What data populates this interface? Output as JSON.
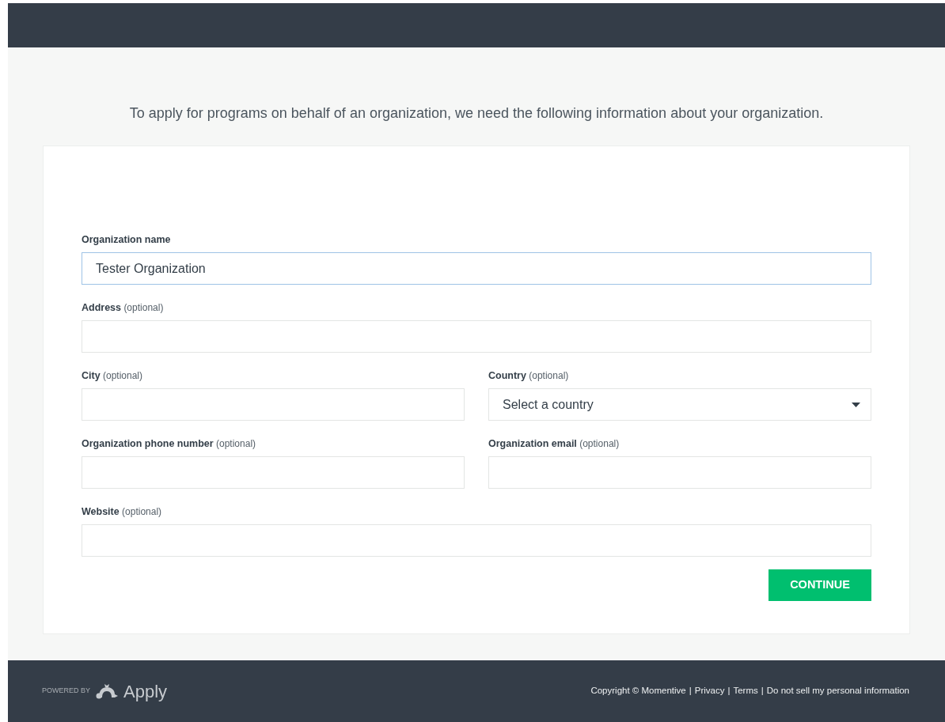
{
  "intro": "To apply for programs on behalf of an organization, we need the following information about your organization.",
  "form": {
    "rows": [
      [
        {
          "label": "Organization name",
          "kind": "text",
          "value": "Tester Organization",
          "focused": true
        }
      ],
      [
        {
          "label": "Address",
          "note": "(optional)",
          "kind": "text",
          "focused": false
        }
      ],
      [
        {
          "label": "City",
          "note": "(optional)",
          "kind": "text",
          "focused": false
        },
        {
          "label": "Country",
          "note": "(optional)",
          "kind": "select",
          "value": "Select a country",
          "focused": false
        }
      ],
      [
        {
          "label": "Organization phone number",
          "note": "(optional)",
          "kind": "text",
          "focused": false
        },
        {
          "label": "Organization email",
          "note": "(optional)",
          "kind": "text",
          "focused": false
        }
      ],
      [
        {
          "label": "Website",
          "note": "(optional)",
          "kind": "text",
          "focused": false
        }
      ]
    ],
    "submit": "CONTINUE"
  },
  "footer": {
    "powered_by": "POWERED BY",
    "brand": "Apply",
    "links": [
      "Copyright © Momentive",
      "Privacy",
      "Terms",
      "Do not sell my personal information"
    ],
    "separator": "|"
  }
}
